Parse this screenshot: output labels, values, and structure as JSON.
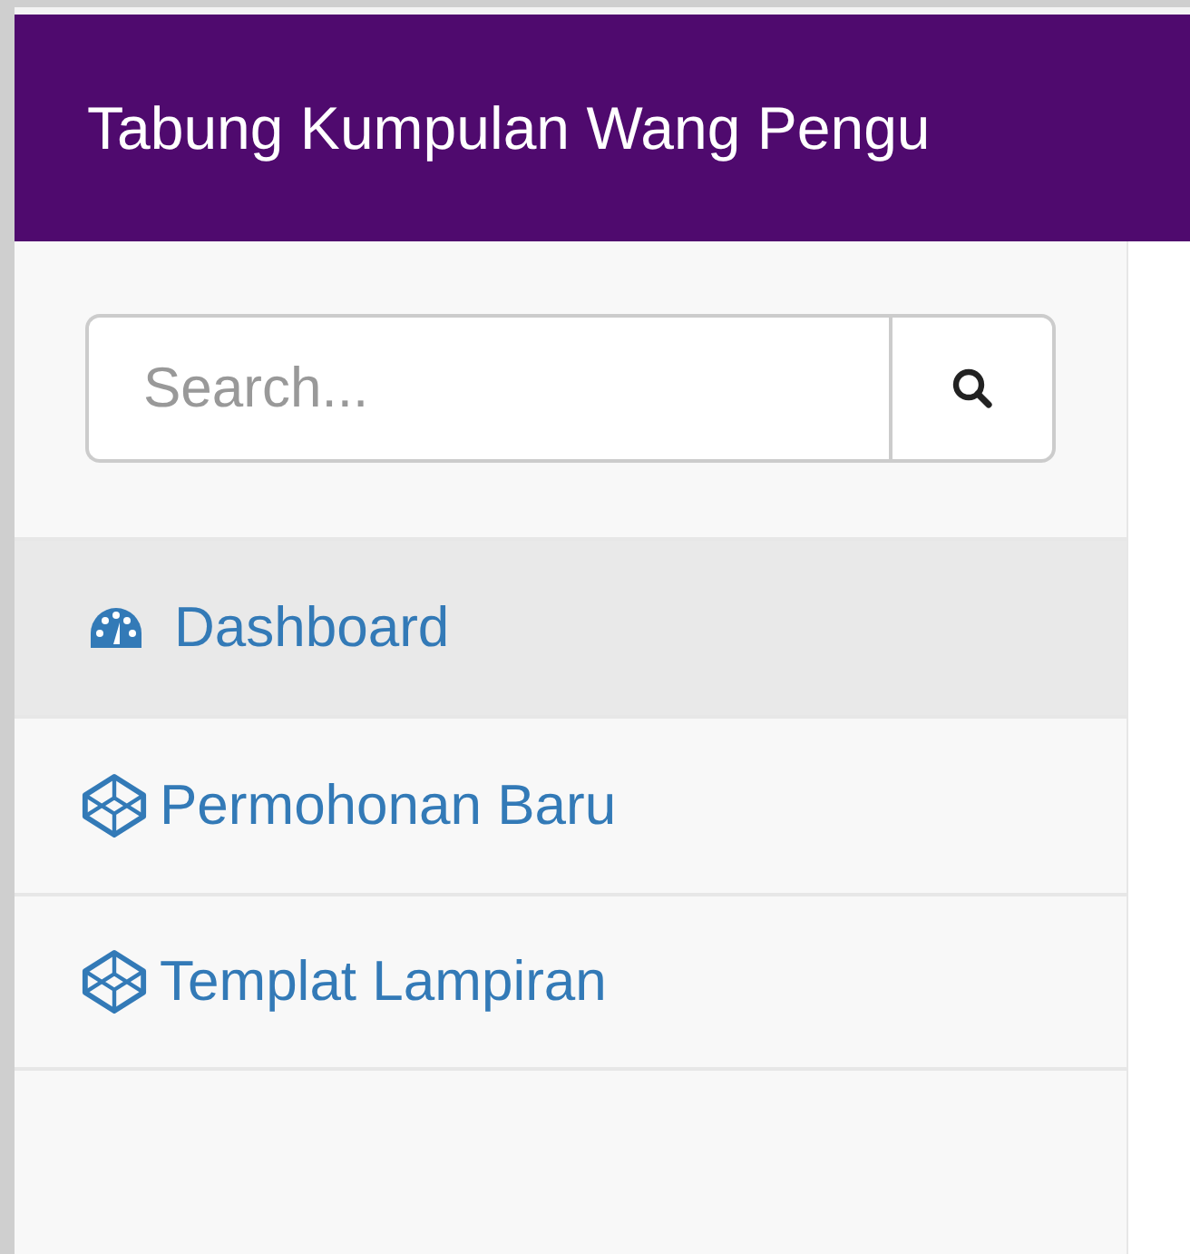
{
  "header": {
    "title": "Tabung Kumpulan Wang Pengu"
  },
  "search": {
    "placeholder": "Search..."
  },
  "nav": [
    {
      "label": "Dashboard",
      "kind": "dashboard",
      "selected": true
    },
    {
      "label": "Permohonan Baru",
      "kind": "cube",
      "selected": false
    },
    {
      "label": "Templat Lampiran",
      "kind": "cube",
      "selected": false
    }
  ]
}
